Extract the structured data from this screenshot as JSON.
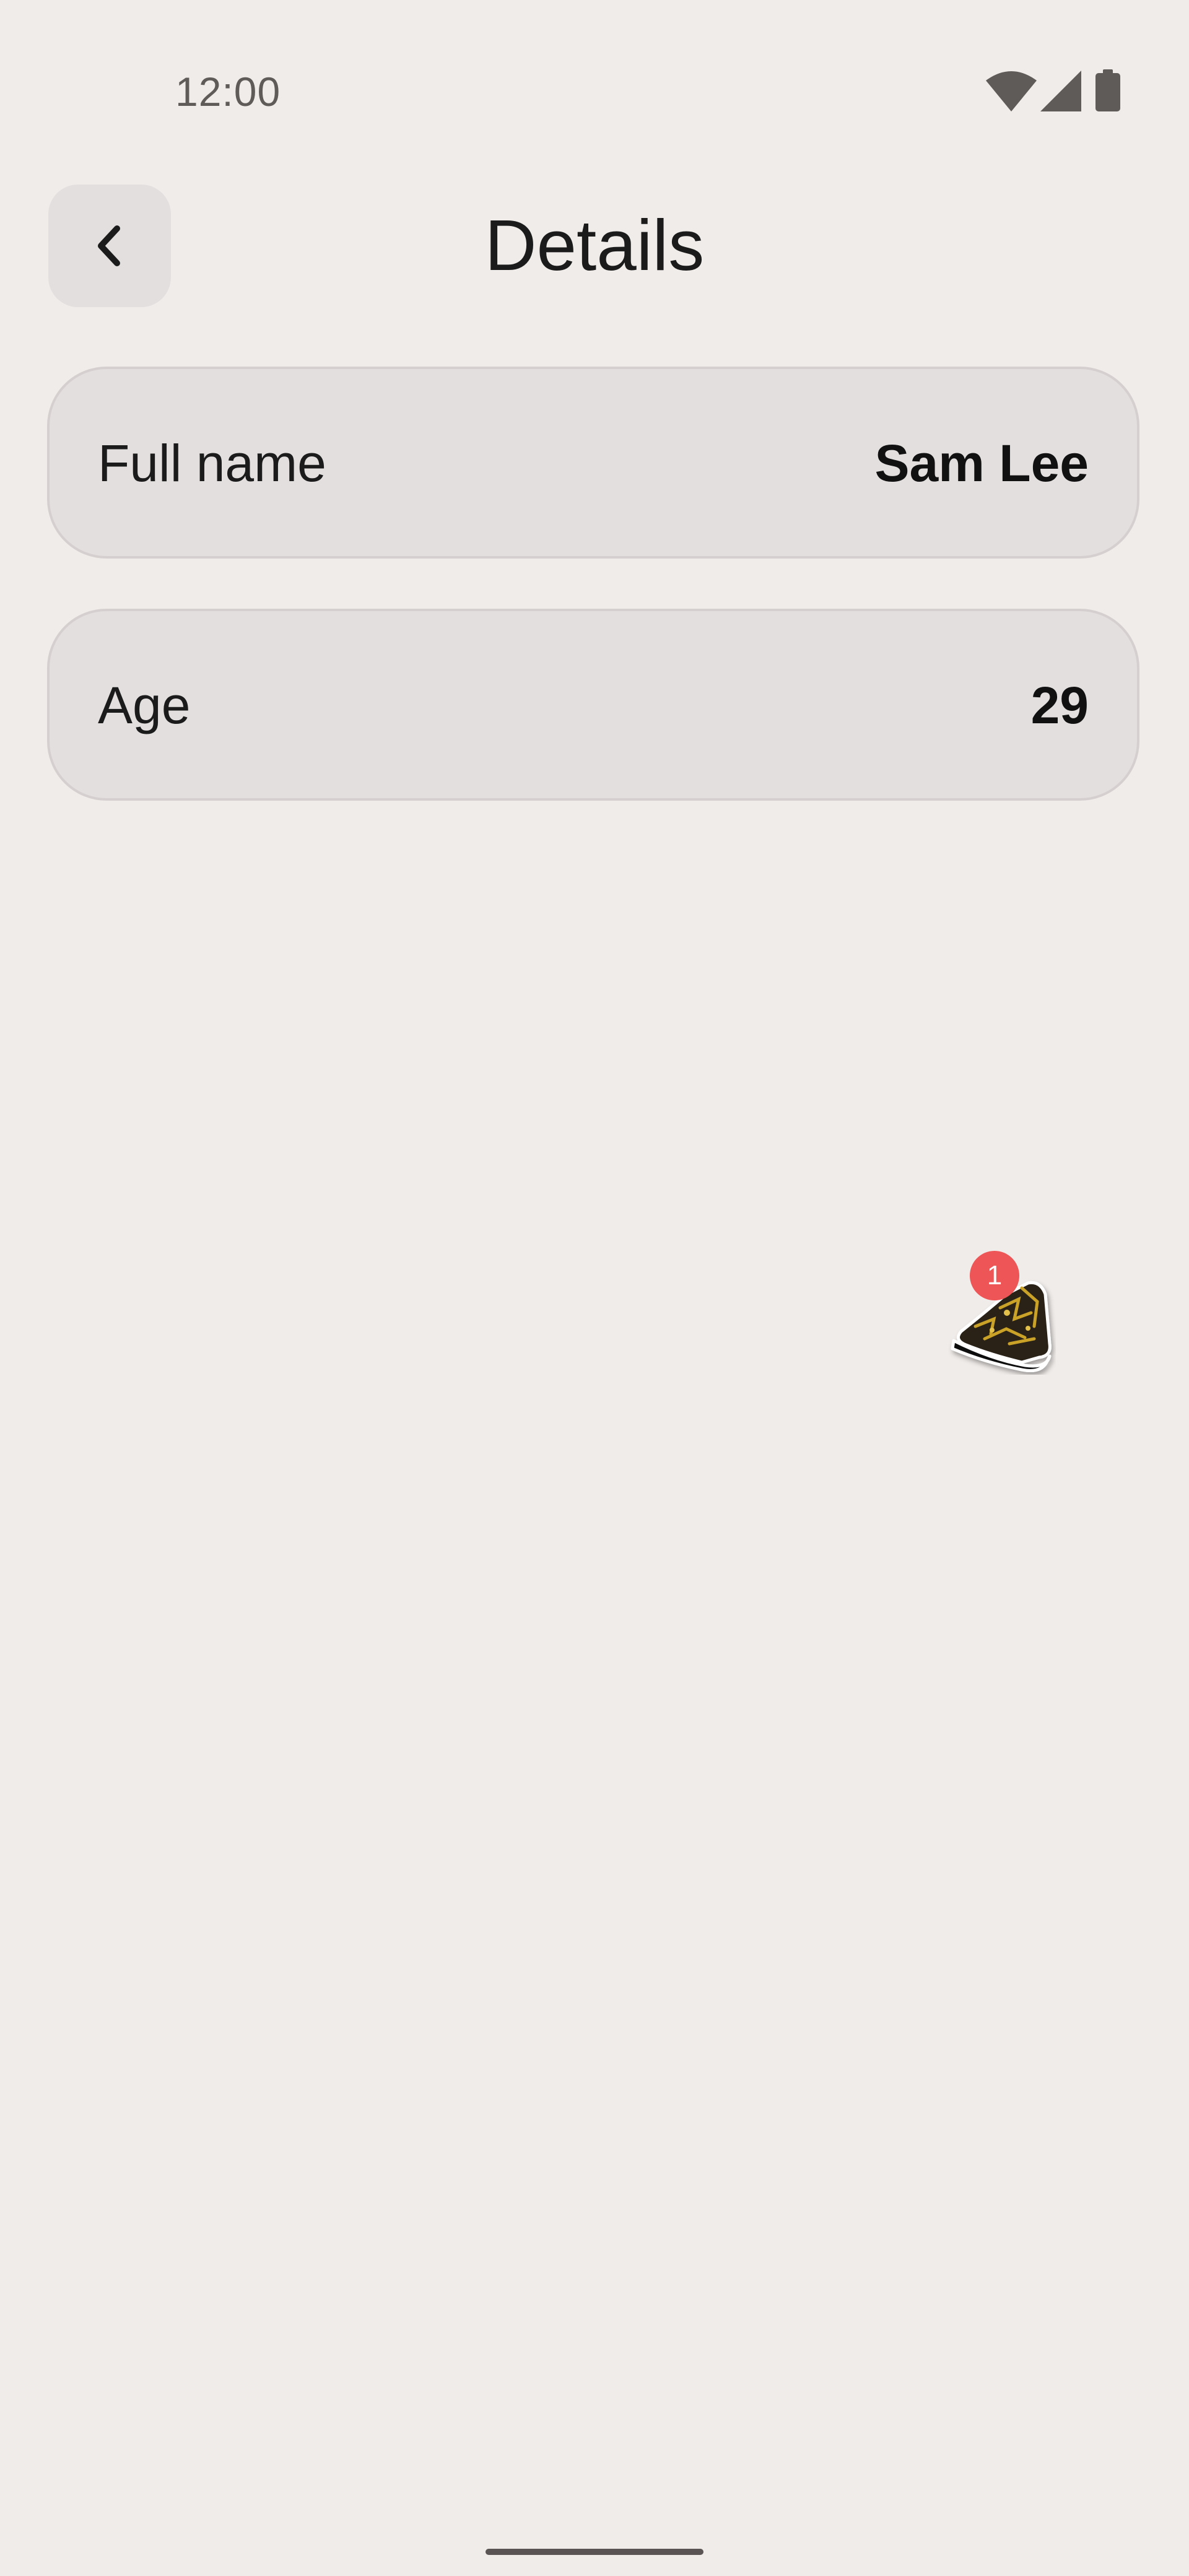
{
  "status_bar": {
    "time": "12:00",
    "icons": [
      "wifi-icon",
      "signal-icon",
      "battery-icon"
    ]
  },
  "header": {
    "title": "Details",
    "back_icon": "chevron-left-icon"
  },
  "details": [
    {
      "label": "Full name",
      "value": "Sam Lee"
    },
    {
      "label": "Age",
      "value": "29"
    }
  ],
  "floating_widget": {
    "badge_count": "1",
    "icon": "shoe-icon",
    "badge_color": "#ee5556"
  },
  "colors": {
    "background": "#f0ecea",
    "card": "#e4dfdf",
    "text": "#1b1b1b",
    "status_text": "#5f5b59"
  }
}
